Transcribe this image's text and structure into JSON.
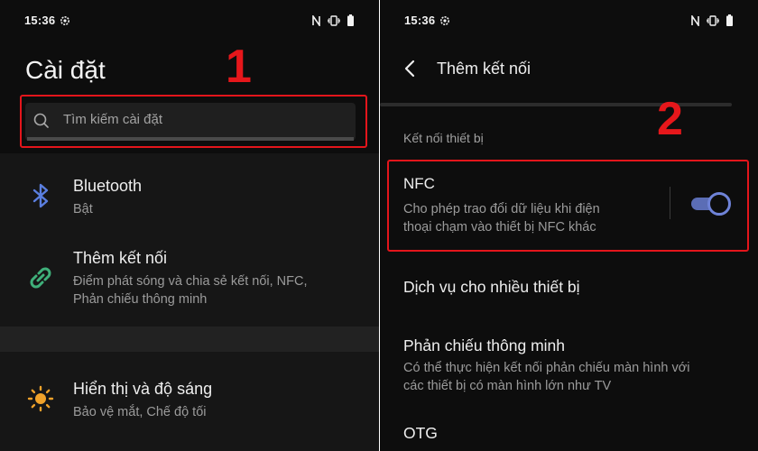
{
  "left": {
    "status": {
      "time": "15:36"
    },
    "title": "Cài đặt",
    "search": {
      "placeholder": "Tìm kiếm cài đặt"
    },
    "step_number": "1",
    "items": [
      {
        "title": "Bluetooth",
        "subtitle": "Bật",
        "icon": "bluetooth-icon"
      },
      {
        "title": "Thêm kết nối",
        "subtitle_line1": "Điểm phát sóng và chia sẻ kết nối, NFC,",
        "subtitle_line2": "Phản chiếu thông minh",
        "icon": "link-icon"
      },
      {
        "title": "Hiển thị và độ sáng",
        "subtitle": "Bảo vệ mắt, Chế độ tối",
        "icon": "sun-icon"
      }
    ]
  },
  "right": {
    "status": {
      "time": "15:36"
    },
    "header": {
      "title": "Thêm kết nối"
    },
    "step_number": "2",
    "section_label": "Kết nối thiết bị",
    "nfc": {
      "title": "NFC",
      "desc_line1": "Cho phép trao đổi dữ liệu khi điện",
      "desc_line2": "thoại chạm vào thiết bị NFC khác",
      "enabled": true
    },
    "items": [
      {
        "title": "Dịch vụ cho nhiều thiết bị"
      },
      {
        "title": "Phản chiếu thông minh",
        "subtitle_line1": "Có thể thực hiện kết nối phản chiếu màn hình với",
        "subtitle_line2": "các thiết bị có màn hình lớn như TV"
      },
      {
        "title": "OTG"
      }
    ]
  },
  "colors": {
    "background": "#0d0d0d",
    "highlight_red": "#e3151b",
    "toggle_accent": "#6f83d8",
    "bluetooth_icon": "#5b7fe0",
    "link_icon": "#3fb07a",
    "sun_icon": "#f0a22a"
  }
}
